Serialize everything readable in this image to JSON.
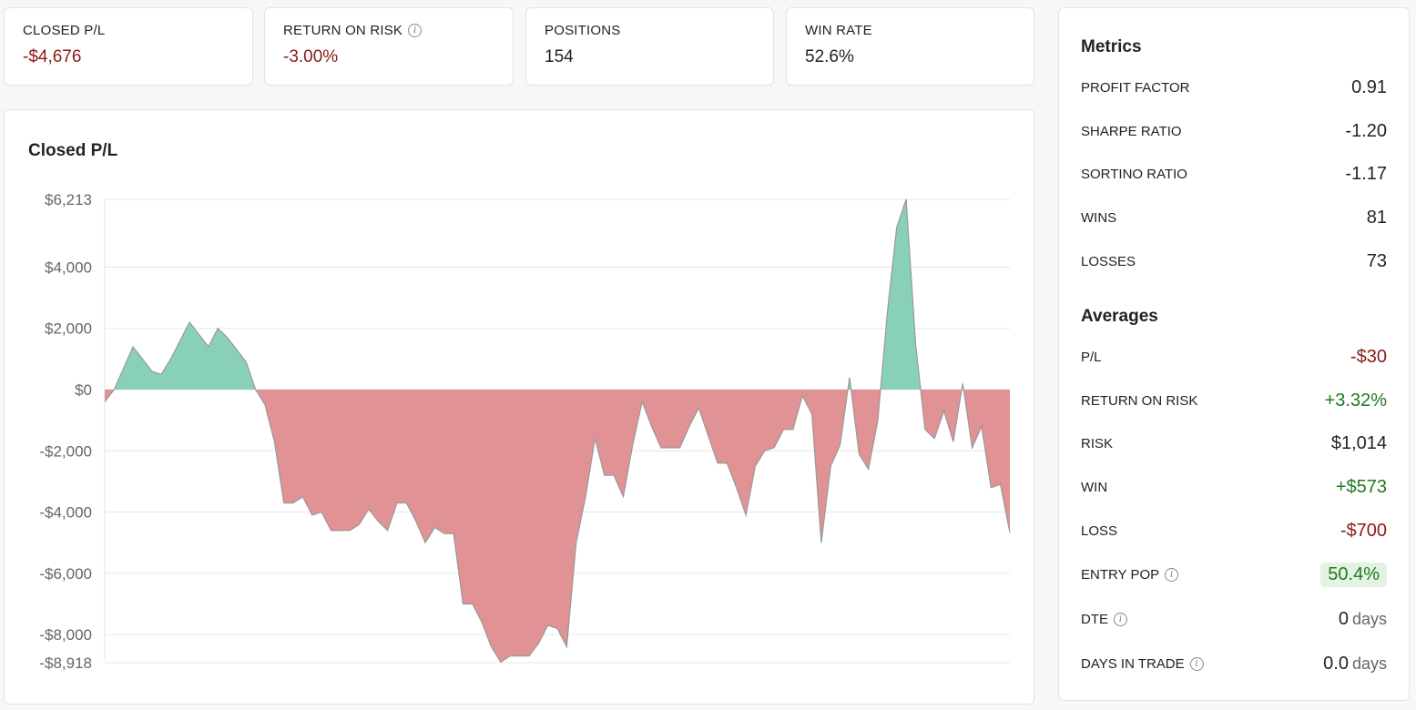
{
  "stats": [
    {
      "label": "CLOSED P/L",
      "value": "-$4,676",
      "tone": "neg",
      "info": false
    },
    {
      "label": "RETURN ON RISK",
      "value": "-3.00%",
      "tone": "neg",
      "info": true
    },
    {
      "label": "POSITIONS",
      "value": "154",
      "tone": "",
      "info": false
    },
    {
      "label": "WIN RATE",
      "value": "52.6%",
      "tone": "",
      "info": false
    }
  ],
  "metrics": {
    "title": "Metrics",
    "rows": [
      {
        "label": "PROFIT FACTOR",
        "value": "0.91"
      },
      {
        "label": "SHARPE RATIO",
        "value": "-1.20"
      },
      {
        "label": "SORTINO RATIO",
        "value": "-1.17"
      },
      {
        "label": "WINS",
        "value": "81"
      },
      {
        "label": "LOSSES",
        "value": "73"
      }
    ]
  },
  "averages": {
    "title": "Averages",
    "rows": [
      {
        "label": "P/L",
        "value": "-$30",
        "tone": "neg"
      },
      {
        "label": "RETURN ON RISK",
        "value": "+3.32%",
        "tone": "pos"
      },
      {
        "label": "RISK",
        "value": "$1,014",
        "tone": ""
      },
      {
        "label": "WIN",
        "value": "+$573",
        "tone": "pos"
      },
      {
        "label": "LOSS",
        "value": "-$700",
        "tone": "neg"
      },
      {
        "label": "ENTRY POP",
        "value": "50.4%",
        "tone": "pill",
        "info": true
      },
      {
        "label": "DTE",
        "value": "0",
        "unit": "days",
        "info": true
      },
      {
        "label": "DAYS IN TRADE",
        "value": "0.0",
        "unit": "days",
        "info": true
      }
    ]
  },
  "colors": {
    "positive": "#88d1b8",
    "negative": "#e09294",
    "line": "#999999",
    "grid": "#e6e6e6",
    "neg_text": "#8b1a1a",
    "pos_text": "#1f7a1f"
  },
  "chart_data": {
    "type": "area",
    "title": "Closed P/L",
    "yticks": [
      6213,
      4000,
      2000,
      0,
      -2000,
      -4000,
      -6000,
      -8000,
      -8918
    ],
    "ytick_labels": [
      "$6,213",
      "$4,000",
      "$2,000",
      "$0",
      "-$2,000",
      "-$4,000",
      "-$6,000",
      "-$8,000",
      "-$8,918"
    ],
    "ylim": [
      -8918,
      6213
    ],
    "values": [
      -400,
      0,
      700,
      1400,
      1000,
      600,
      500,
      1000,
      1600,
      2200,
      1800,
      1400,
      2000,
      1700,
      1300,
      900,
      0,
      -500,
      -1700,
      -3700,
      -3700,
      -3500,
      -4100,
      -4000,
      -4600,
      -4600,
      -4600,
      -4400,
      -3900,
      -4300,
      -4600,
      -3700,
      -3700,
      -4300,
      -5000,
      -4500,
      -4700,
      -4700,
      -7000,
      -7000,
      -7600,
      -8400,
      -8900,
      -8700,
      -8700,
      -8700,
      -8300,
      -7700,
      -7800,
      -8400,
      -5000,
      -3500,
      -1600,
      -2800,
      -2800,
      -3500,
      -1800,
      -400,
      -1200,
      -1900,
      -1900,
      -1900,
      -1200,
      -600,
      -1500,
      -2400,
      -2400,
      -3200,
      -4100,
      -2500,
      -2000,
      -1900,
      -1300,
      -1300,
      -200,
      -800,
      -5000,
      -2500,
      -1800,
      400,
      -2100,
      -2600,
      -1000,
      2500,
      5300,
      6213,
      1500,
      -1300,
      -1600,
      -700,
      -1700,
      200,
      -1900,
      -1200,
      -3200,
      -3100,
      -4676
    ]
  }
}
